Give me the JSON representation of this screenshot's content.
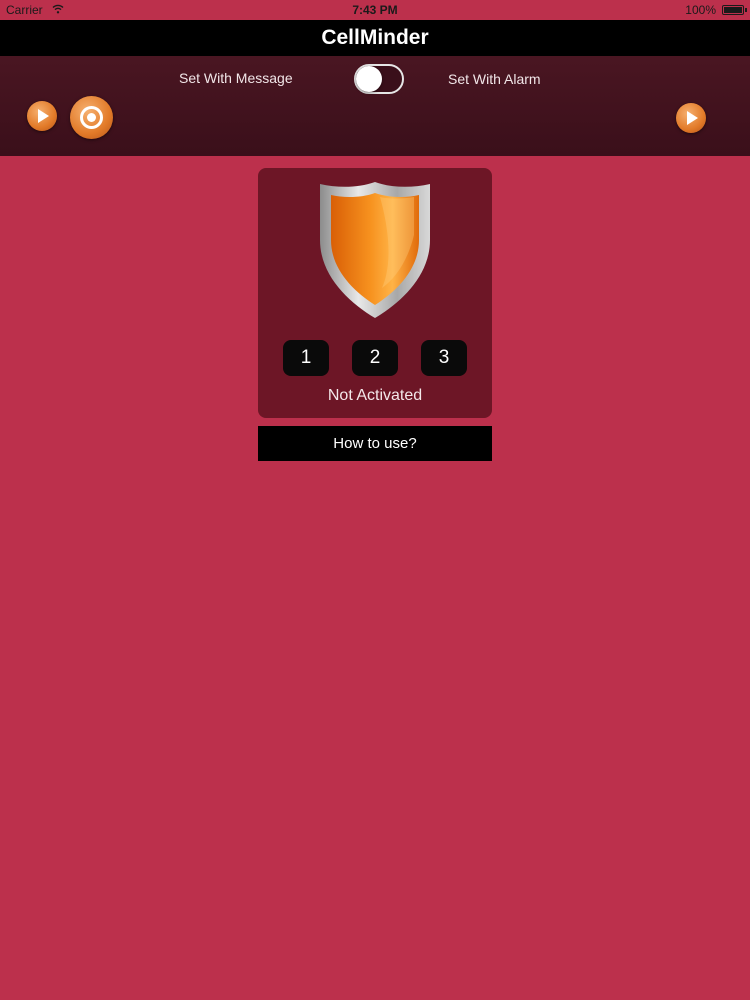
{
  "status_bar": {
    "carrier": "Carrier",
    "time": "7:43 PM",
    "battery": "100%"
  },
  "app": {
    "title": "CellMinder"
  },
  "toolbar": {
    "message_label": "Set With Message",
    "alarm_label": "Set With Alarm",
    "toggle_on": false
  },
  "card": {
    "numbers": [
      "1",
      "2",
      "3"
    ],
    "status": "Not Activated"
  },
  "help_button": "How to use?",
  "colors": {
    "background": "#bc304c",
    "toolbar": "#3a0f1a",
    "card": "#6d1626",
    "accent": "#e27a28"
  }
}
